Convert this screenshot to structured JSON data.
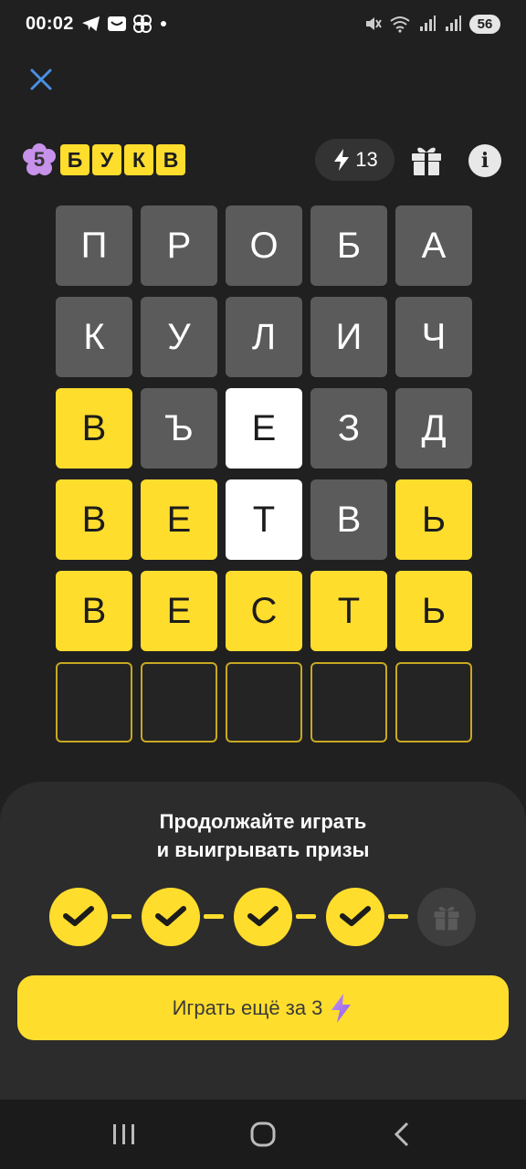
{
  "status_bar": {
    "time": "00:02",
    "left_icons": [
      "telegram-icon",
      "mail-icon",
      "pinwheel-icon",
      "dot-icon"
    ],
    "right_icons": [
      "mute-icon",
      "wifi-icon",
      "signal-icon",
      "signal-icon"
    ],
    "battery": "56"
  },
  "header": {
    "logo_number": "5",
    "logo_letters": [
      "Б",
      "У",
      "К",
      "В"
    ],
    "energy_count": "13"
  },
  "board": {
    "rows": [
      [
        {
          "letter": "П",
          "state": "gray"
        },
        {
          "letter": "Р",
          "state": "gray"
        },
        {
          "letter": "О",
          "state": "gray"
        },
        {
          "letter": "Б",
          "state": "gray"
        },
        {
          "letter": "А",
          "state": "gray"
        }
      ],
      [
        {
          "letter": "К",
          "state": "gray"
        },
        {
          "letter": "У",
          "state": "gray"
        },
        {
          "letter": "Л",
          "state": "gray"
        },
        {
          "letter": "И",
          "state": "gray"
        },
        {
          "letter": "Ч",
          "state": "gray"
        }
      ],
      [
        {
          "letter": "В",
          "state": "yellow"
        },
        {
          "letter": "Ъ",
          "state": "gray"
        },
        {
          "letter": "Е",
          "state": "white"
        },
        {
          "letter": "З",
          "state": "gray"
        },
        {
          "letter": "Д",
          "state": "gray"
        }
      ],
      [
        {
          "letter": "В",
          "state": "yellow"
        },
        {
          "letter": "Е",
          "state": "yellow"
        },
        {
          "letter": "Т",
          "state": "white"
        },
        {
          "letter": "В",
          "state": "gray"
        },
        {
          "letter": "Ь",
          "state": "yellow"
        }
      ],
      [
        {
          "letter": "В",
          "state": "yellow"
        },
        {
          "letter": "Е",
          "state": "yellow"
        },
        {
          "letter": "С",
          "state": "yellow"
        },
        {
          "letter": "Т",
          "state": "yellow"
        },
        {
          "letter": "Ь",
          "state": "yellow"
        }
      ],
      [
        {
          "letter": "",
          "state": "empty"
        },
        {
          "letter": "",
          "state": "empty"
        },
        {
          "letter": "",
          "state": "empty"
        },
        {
          "letter": "",
          "state": "empty"
        },
        {
          "letter": "",
          "state": "empty"
        }
      ]
    ]
  },
  "sheet": {
    "title_line1": "Продолжайте играть",
    "title_line2": "и выигрывать призы",
    "progress": {
      "completed": 4,
      "total": 5,
      "final_reward": "gift-icon"
    },
    "play_button_label": "Играть ещё за 3"
  },
  "colors": {
    "background": "#202020",
    "accent_yellow": "#ffdd2d",
    "tile_gray": "#5b5b5b",
    "sheet": "#2c2c2c",
    "logo_flower": "#c792ea"
  }
}
